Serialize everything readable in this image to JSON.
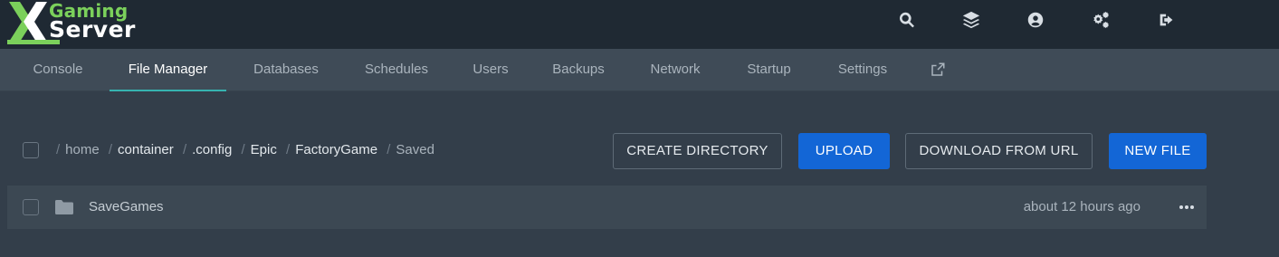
{
  "brand": {
    "line1": "Gaming",
    "line2": "Server",
    "colors": {
      "green": "#7bd05b",
      "white": "#ffffff"
    }
  },
  "header_icons": [
    "search-icon",
    "layers-icon",
    "user-circle-icon",
    "gears-icon",
    "sign-out-icon"
  ],
  "tabs": [
    {
      "label": "Console"
    },
    {
      "label": "File Manager",
      "active": true
    },
    {
      "label": "Databases"
    },
    {
      "label": "Schedules"
    },
    {
      "label": "Users"
    },
    {
      "label": "Backups"
    },
    {
      "label": "Network"
    },
    {
      "label": "Startup"
    },
    {
      "label": "Settings"
    }
  ],
  "breadcrumb": [
    "home",
    "container",
    ".config",
    "Epic",
    "FactoryGame",
    "Saved"
  ],
  "actions": {
    "create_directory": "CREATE DIRECTORY",
    "upload": "UPLOAD",
    "download_from_url": "DOWNLOAD FROM URL",
    "new_file": "NEW FILE"
  },
  "files": [
    {
      "name": "SaveGames",
      "modified": "about 12 hours ago",
      "type": "folder"
    }
  ],
  "colors": {
    "accent_tab": "#36b3b0",
    "primary_button": "#1366d6",
    "page_bg": "#333e4a",
    "topbar_bg": "#1f2933",
    "subnav_bg": "#3f4b57"
  }
}
